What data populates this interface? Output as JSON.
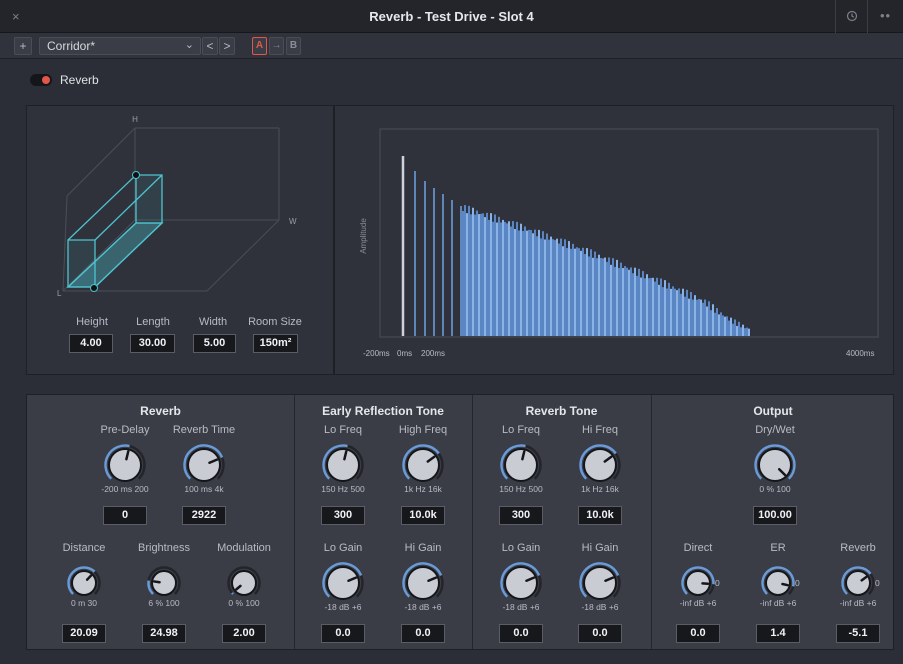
{
  "window": {
    "title": "Reverb - Test Drive -  Slot 4",
    "close_glyph": "×",
    "history_icon": "history-icon",
    "more_glyph": "••"
  },
  "toolbar": {
    "add_glyph": "+",
    "preset_name": "Corridor*",
    "preset_chevron": "⌄",
    "prev_glyph": "<",
    "next_glyph": ">",
    "compare_a": "A",
    "compare_arrow": "→",
    "compare_b": "B"
  },
  "enable": {
    "label": "Reverb",
    "on": true,
    "accent": "#e2574a"
  },
  "room": {
    "axis_h": "H",
    "axis_w": "W",
    "axis_l": "L",
    "height_label": "Height",
    "length_label": "Length",
    "width_label": "Width",
    "roomsize_label": "Room Size",
    "height_value": "4.00",
    "length_value": "30.00",
    "width_value": "5.00",
    "roomsize_value": "150m²",
    "wire_color": "#4ec3d0"
  },
  "graph": {
    "y_label": "Amplitude",
    "tick_neg200": "-200ms",
    "tick_0": "0ms",
    "tick_200": "200ms",
    "tick_4000": "4000ms",
    "bar_color": "#6a9bd8"
  },
  "sections": {
    "reverb": {
      "title": "Reverb",
      "predelay_label": "Pre-Delay",
      "predelay_scale": "-200  ms  200",
      "predelay_value": "0",
      "reverbtime_label": "Reverb Time",
      "reverbtime_scale": "100  ms  4k",
      "reverbtime_value": "2922",
      "distance_label": "Distance",
      "distance_scale": "0   m   30",
      "distance_value": "20.09",
      "brightness_label": "Brightness",
      "brightness_scale": "6   %   100",
      "brightness_value": "24.98",
      "modulation_label": "Modulation",
      "modulation_scale": "0   %   100",
      "modulation_value": "2.00"
    },
    "early": {
      "title": "Early Reflection Tone",
      "lofreq_label": "Lo Freq",
      "lofreq_scale": "150  Hz  500",
      "lofreq_value": "300",
      "hifreq_label": "High Freq",
      "hifreq_scale": "1k  Hz  16k",
      "hifreq_value": "10.0k",
      "logain_label": "Lo Gain",
      "logain_scale": "-18  dB  +6",
      "logain_value": "0.0",
      "higain_label": "Hi Gain",
      "higain_scale": "-18  dB  +6",
      "higain_value": "0.0"
    },
    "tone": {
      "title": "Reverb Tone",
      "lofreq_label": "Lo Freq",
      "lofreq_scale": "150  Hz  500",
      "lofreq_value": "300",
      "hifreq_label": "Hi Freq",
      "hifreq_scale": "1k  Hz  16k",
      "hifreq_value": "10.0k",
      "logain_label": "Lo Gain",
      "logain_scale": "-18  dB  +6",
      "logain_value": "0.0",
      "higain_label": "Hi Gain",
      "higain_scale": "-18  dB  +6",
      "higain_value": "0.0"
    },
    "output": {
      "title": "Output",
      "drywet_label": "Dry/Wet",
      "drywet_scale": "0   %   100",
      "drywet_value": "100.00",
      "direct_label": "Direct",
      "direct_scale": "-inf  dB  +6",
      "direct_value": "0.0",
      "er_label": "ER",
      "er_scale": "-inf  dB  +6",
      "er_value": "1.4",
      "reverb_label": "Reverb",
      "reverb_scale": "-inf  dB  +6",
      "reverb_value": "-5.1",
      "zero_mark": "0"
    }
  }
}
